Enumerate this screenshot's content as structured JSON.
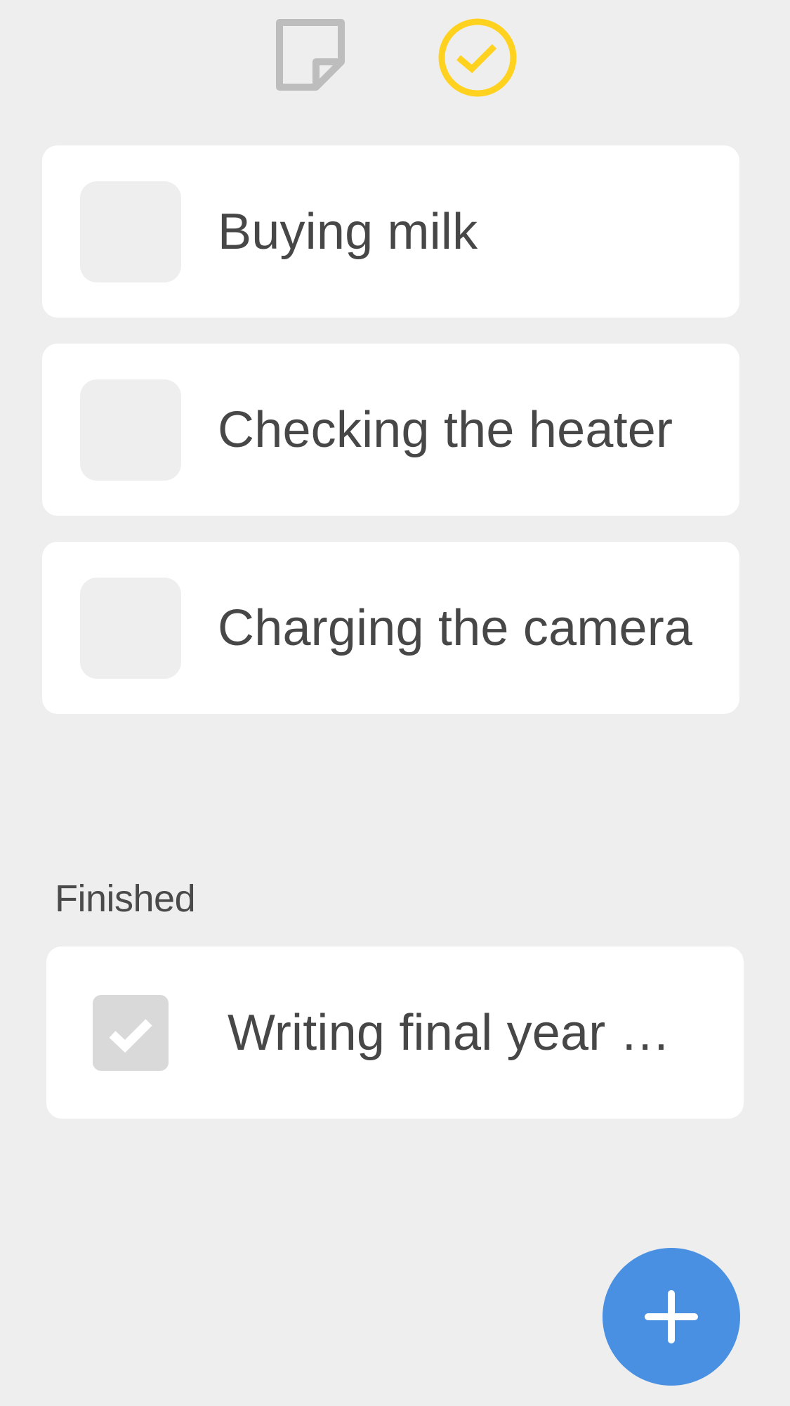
{
  "header": {
    "tabs": [
      {
        "icon": "note-icon",
        "color": "#bdbdbd",
        "selected": false
      },
      {
        "icon": "check-circle-icon",
        "color": "#ffd21f",
        "selected": true
      }
    ]
  },
  "todos": {
    "items": [
      {
        "label": "Buying milk",
        "checked": false
      },
      {
        "label": "Checking the heater",
        "checked": false
      },
      {
        "label": "Charging the camera",
        "checked": false
      }
    ]
  },
  "finished": {
    "section_label": "Finished",
    "items": [
      {
        "label": "Writing final year …",
        "checked": true
      }
    ]
  },
  "fab": {
    "icon": "plus-icon",
    "color": "#4a90e2"
  }
}
